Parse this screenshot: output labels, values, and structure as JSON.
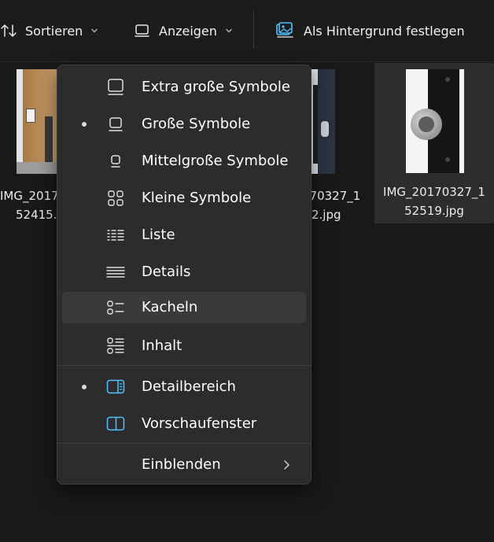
{
  "toolbar": {
    "sort_label": "Sortieren",
    "view_label": "Anzeigen",
    "set_background_label": "Als Hintergrund festlegen"
  },
  "files": [
    {
      "name_line1": "IMG_2017",
      "name_line2": "52415."
    },
    {
      "name_line1": "170327_1",
      "name_line2": "2.jpg"
    },
    {
      "name_line1": "IMG_20170327_1",
      "name_line2": "52519.jpg"
    }
  ],
  "menu": {
    "items": [
      {
        "label": "Extra große Symbole",
        "icon": "monitor-xl-icon",
        "checked": false
      },
      {
        "label": "Große Symbole",
        "icon": "monitor-large-icon",
        "checked": true
      },
      {
        "label": "Mittelgroße Symbole",
        "icon": "monitor-medium-icon",
        "checked": false
      },
      {
        "label": "Kleine Symbole",
        "icon": "small-icons-grid-icon",
        "checked": false
      },
      {
        "label": "Liste",
        "icon": "list-icon",
        "checked": false
      },
      {
        "label": "Details",
        "icon": "details-icon",
        "checked": false
      },
      {
        "label": "Kacheln",
        "icon": "tiles-icon",
        "checked": false,
        "hovered": true
      },
      {
        "label": "Inhalt",
        "icon": "content-icon",
        "checked": false
      },
      {
        "label": "Detailbereich",
        "icon": "details-pane-icon",
        "checked": true
      },
      {
        "label": "Vorschaufenster",
        "icon": "preview-pane-icon",
        "checked": false
      },
      {
        "label": "Einblenden",
        "icon": "",
        "submenu": true
      }
    ]
  },
  "colors": {
    "accent": "#4cc2ff",
    "background": "#191919",
    "menu_background": "#2c2c2c",
    "hover": "#3a3a3a"
  }
}
